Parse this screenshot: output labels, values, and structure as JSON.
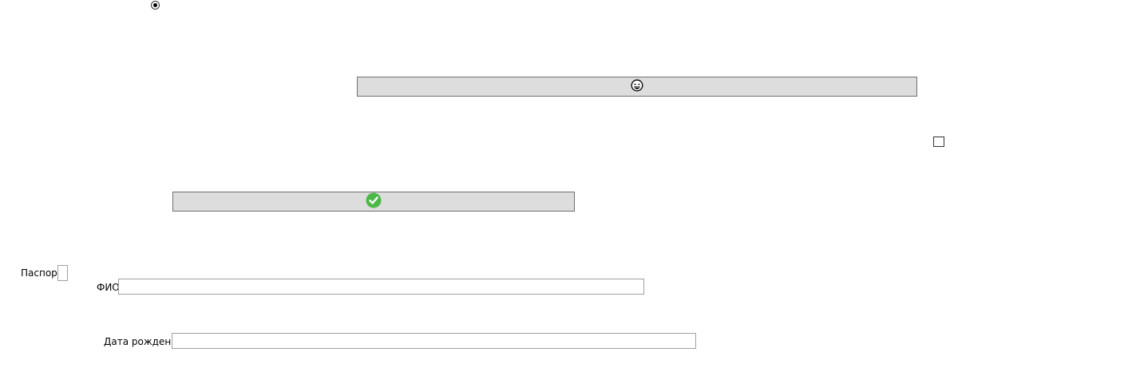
{
  "radio": {
    "selected": true
  },
  "buttons": {
    "emoji": {
      "icon": "grinning-face-emoji-icon"
    },
    "confirm": {
      "icon": "green-checkmark-icon",
      "icon_color": "#4cb848"
    }
  },
  "checkbox": {
    "checked": false
  },
  "form": {
    "passport_label": "Паспорт",
    "fio_label": "ФИО",
    "fio_value": "",
    "dob_label": "Дата рождения",
    "dob_value": ""
  },
  "colors": {
    "button_bg": "#dddddd",
    "button_border": "#707070",
    "input_border": "#a0a0a0"
  }
}
